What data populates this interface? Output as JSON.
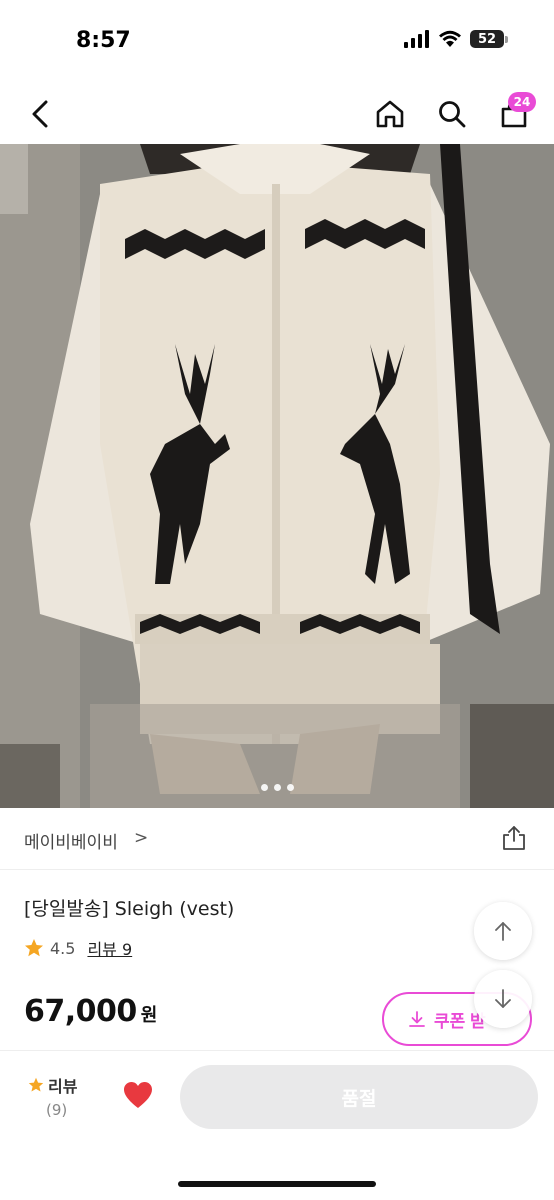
{
  "status": {
    "time": "8:57",
    "battery": "52"
  },
  "nav": {
    "cart_badge": "24"
  },
  "image": {
    "icon": "product-photo",
    "current_page": 1,
    "page_count": 3
  },
  "brand": {
    "name": "메이비베이비",
    "chevron": ">"
  },
  "product": {
    "title": "[당일발송] Sleigh (vest)",
    "rating": "4.5",
    "review_link": "리뷰 9",
    "price": "67,000",
    "currency": "원"
  },
  "coupon": {
    "label": "쿠폰 받"
  },
  "bottom": {
    "review_label": "리뷰",
    "review_count": "(9)",
    "buy_label": "품절"
  },
  "colors": {
    "accent": "#e94bd6",
    "star": "#f5a623",
    "heart": "#e8393f",
    "disabled": "#e9e9ea"
  }
}
